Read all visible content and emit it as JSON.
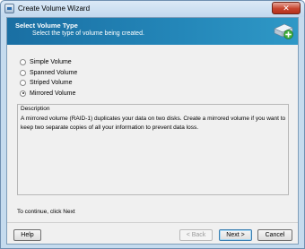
{
  "window": {
    "title": "Create Volume Wizard",
    "close_glyph": "✕"
  },
  "banner": {
    "title": "Select Volume Type",
    "subtitle": "Select the type of volume being created.",
    "icon": "disk-add-icon"
  },
  "volume_types": [
    {
      "label": "Simple Volume",
      "checked": false
    },
    {
      "label": "Spanned Volume",
      "checked": false
    },
    {
      "label": "Striped Volume",
      "checked": false
    },
    {
      "label": "Mirrored Volume",
      "checked": true
    }
  ],
  "description": {
    "heading": "Description",
    "text": "A mirrored volume (RAID-1) duplicates your data on two disks. Create a mirrored volume if you want to keep two separate copies of all your information to prevent data loss."
  },
  "footer": {
    "instruction": "To continue, click Next"
  },
  "buttons": {
    "help": "Help",
    "back": "< Back",
    "next": "Next >",
    "cancel": "Cancel"
  },
  "colors": {
    "banner": "#2487b9",
    "close": "#c7442e",
    "accent_border": "#3c7fb1"
  }
}
